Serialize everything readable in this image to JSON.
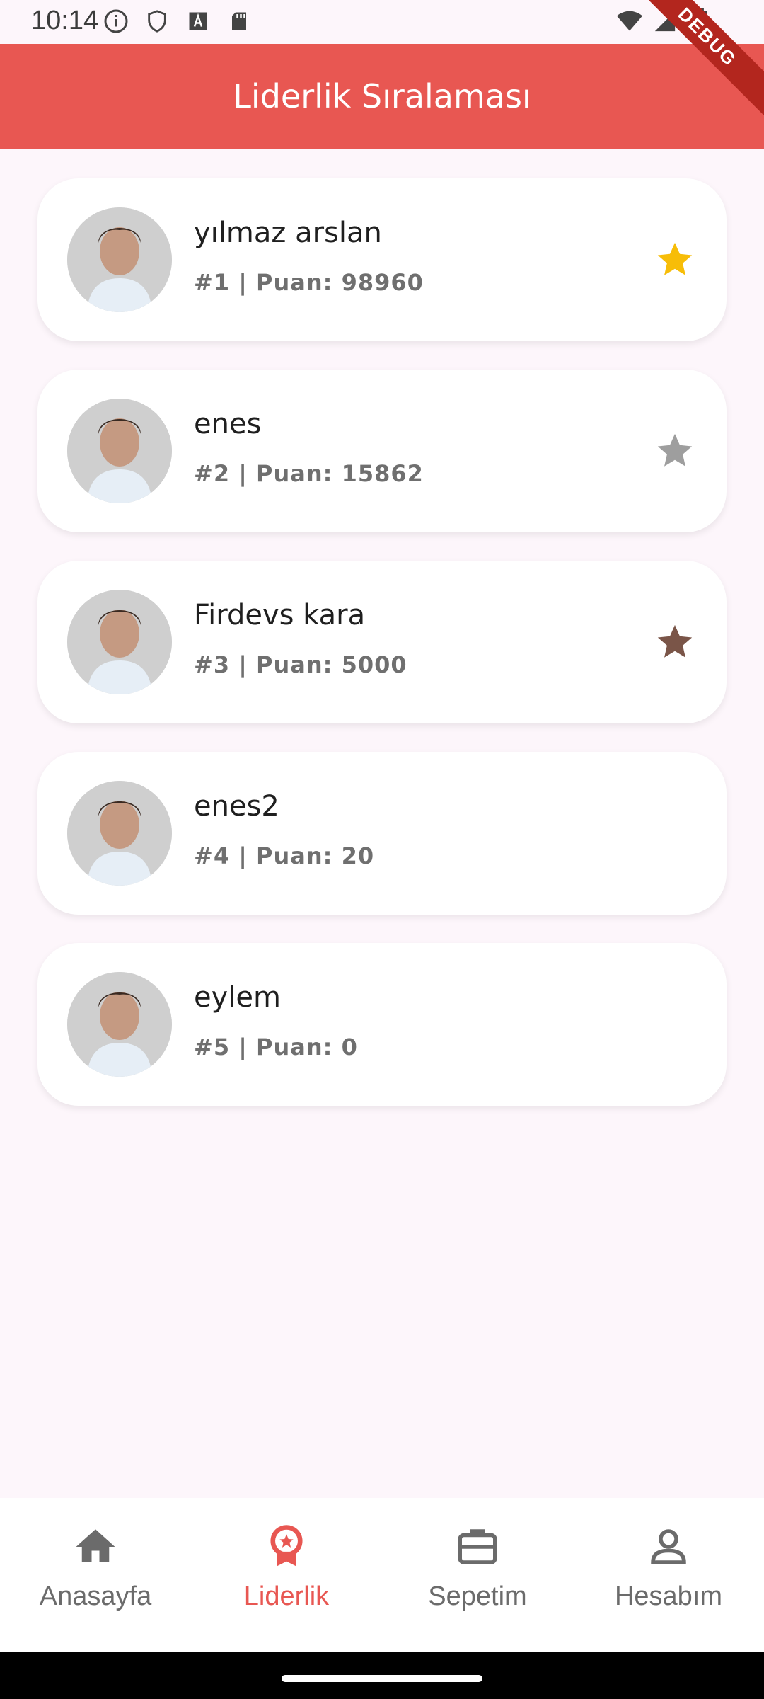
{
  "status": {
    "time": "10:14"
  },
  "debug_label": "DEBUG",
  "appbar": {
    "title": "Liderlik Sıralaması"
  },
  "leaderboard": [
    {
      "name": "yılmaz arslan",
      "subtitle": "#1 | Puan: 98960",
      "star_color": "#f7bd08"
    },
    {
      "name": "enes",
      "subtitle": "#2 | Puan: 15862",
      "star_color": "#9e9e9e"
    },
    {
      "name": "Firdevs kara",
      "subtitle": "#3 | Puan: 5000",
      "star_color": "#7a5548"
    },
    {
      "name": "enes2",
      "subtitle": "#4 | Puan: 20",
      "star_color": null
    },
    {
      "name": "eylem",
      "subtitle": "#5 | Puan: 0",
      "star_color": null
    }
  ],
  "nav": {
    "items": [
      {
        "label": "Anasayfa",
        "icon": "home-icon"
      },
      {
        "label": "Liderlik",
        "icon": "award-icon",
        "active": true
      },
      {
        "label": "Sepetim",
        "icon": "briefcase-icon"
      },
      {
        "label": "Hesabım",
        "icon": "person-icon"
      }
    ]
  },
  "colors": {
    "accent": "#e85752",
    "background": "#fdf6fb"
  }
}
